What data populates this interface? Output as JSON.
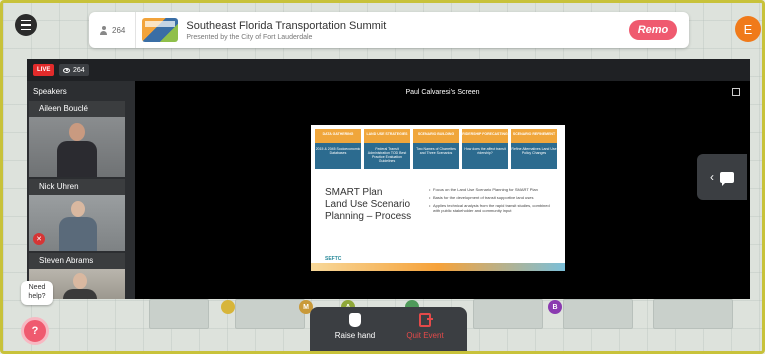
{
  "header": {
    "attendee_count": "264",
    "event_title": "Southeast Florida Transportation Summit",
    "event_subtitle": "Presented by the City of Fort Lauderdale",
    "brand": "Remo",
    "user_initial": "E"
  },
  "stage": {
    "live_label": "LIVE",
    "viewer_count": "264",
    "speakers_label": "Speakers",
    "screen_title": "Paul Calvaresi's Screen"
  },
  "speakers": [
    {
      "name": "Aileen Bouclé"
    },
    {
      "name": "Nick Uhren"
    },
    {
      "name": "Steven Abrams"
    }
  ],
  "slide": {
    "steps": [
      {
        "head": "DATA GATHERING",
        "body": "2015 & 2045 Socioeconomic Databases"
      },
      {
        "head": "LAND USE STRATEGIES",
        "body": "Federal Transit Administration TOD Best Practice Evaluation Guidelines"
      },
      {
        "head": "SCENARIO BUILDING",
        "body": "Two Names of Charrettes and Three Scenarios"
      },
      {
        "head": "RIDERSHIP FORECASTING",
        "body": "How does the affect transit ridership?"
      },
      {
        "head": "SCENARIO REFINEMENT",
        "body": "Refine Alternatives Land Use Policy Changes"
      }
    ],
    "title_lines": [
      "SMART Plan",
      "Land Use Scenario",
      "Planning – Process"
    ],
    "bullets": [
      "Focus on the Land Use Scenario Planning for SMART Plan",
      "Basis for the development of transit supportive land uses",
      "Applies technical analysis from the rapid transit studies, combined with public stakeholder and community input"
    ],
    "logo_text": "SEFTC"
  },
  "help": {
    "text": "Need help?",
    "button": "?"
  },
  "controls": {
    "raise_hand": "Raise hand",
    "quit_event": "Quit Event"
  },
  "seats": [
    "M",
    "A",
    "B"
  ],
  "colors": {
    "accent": "#ef5a6f",
    "live": "#e22b2b",
    "avatar": "#f07a1a",
    "slide_orange": "#f0a63b",
    "slide_blue": "#2c6b8f"
  }
}
